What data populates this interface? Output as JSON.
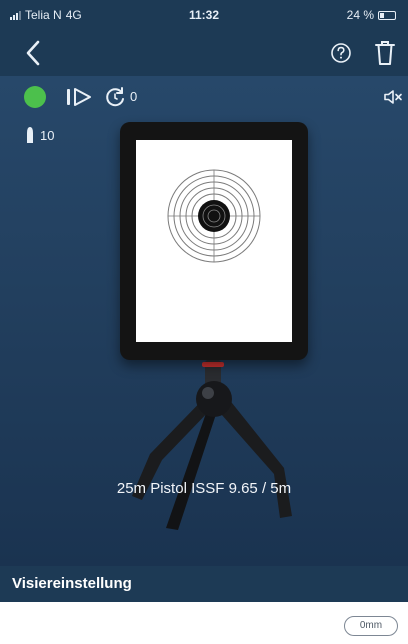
{
  "status_bar": {
    "carrier": "Telia N",
    "network": "4G",
    "time": "11:32",
    "battery_text": "24 %"
  },
  "nav": {
    "back_icon": "chevron-left-icon",
    "help_icon": "question-circle-icon",
    "delete_icon": "trash-icon"
  },
  "toolbar": {
    "status_color": "#4cc04c",
    "timer_count": "0"
  },
  "ammo": {
    "count": "10"
  },
  "scene": {
    "caption": "25m Pistol ISSF 9.65 / 5m"
  },
  "section": {
    "title": "Visiereinstellung"
  },
  "offset": {
    "value": "0mm"
  }
}
